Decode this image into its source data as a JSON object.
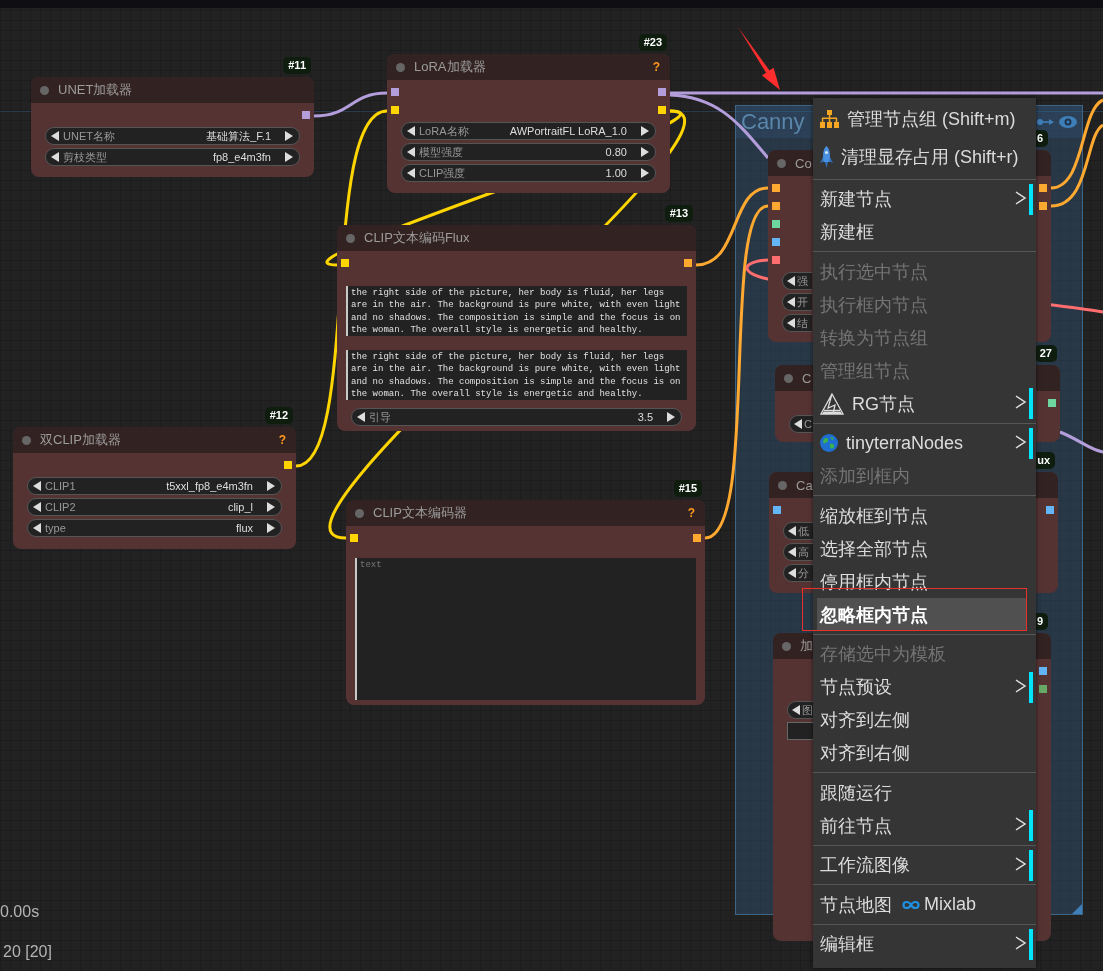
{
  "nodes": [
    {
      "badge": "#11",
      "title": "UNET加载器",
      "outputs": [
        {
          "color": "#b39ddb"
        }
      ],
      "widgets": [
        {
          "label": "UNET名称",
          "value": "基础算法_F.1"
        },
        {
          "label": "剪枝类型",
          "value": "fp8_e4m3fn"
        }
      ]
    },
    {
      "badge": "#23",
      "title": "LoRA加载器",
      "help_mark": "?",
      "inputs": [
        {
          "color": "#b39ddb"
        },
        {
          "color": "#ffd500"
        }
      ],
      "outputs": [
        {
          "color": "#b39ddb"
        },
        {
          "color": "#ffd500"
        }
      ],
      "widgets": [
        {
          "label": "LoRA名称",
          "value": "AWPortraitFL LoRA_1.0"
        },
        {
          "label": "模型强度",
          "value": "0.80"
        },
        {
          "label": "CLIP强度",
          "value": "1.00"
        }
      ]
    },
    {
      "badge": "#13",
      "title": "CLIP文本编码Flux",
      "inputs": [
        {
          "color": "#ffd500"
        }
      ],
      "outputs": [
        {
          "color": "#ffa931"
        }
      ],
      "text_areas": [
        {
          "value": "the right side of the picture, her body is fluid, her legs are in the air. The background is pure white, with even light and no shadows. The composition is simple and the focus is on the woman. The overall style is energetic and healthy."
        },
        {
          "value": "the right side of the picture, her body is fluid, her legs are in the air. The background is pure white, with even light and no shadows. The composition is simple and the focus is on the woman. The overall style is energetic and healthy."
        }
      ],
      "widgets": [
        {
          "label": "引导",
          "value": "3.5"
        }
      ]
    },
    {
      "badge": "#12",
      "title": "双CLIP加载器",
      "help_mark": "?",
      "outputs": [
        {
          "color": "#ffd500"
        }
      ],
      "widgets": [
        {
          "label": "CLIP1",
          "value": "t5xxl_fp8_e4m3fn"
        },
        {
          "label": "CLIP2",
          "value": "clip_l"
        },
        {
          "label": "type",
          "value": "flux"
        }
      ]
    },
    {
      "badge": "#15",
      "title": "CLIP文本编码器",
      "help_mark": "?",
      "inputs": [
        {
          "color": "#ffd500"
        }
      ],
      "outputs": [
        {
          "color": "#ffa931"
        }
      ],
      "text_areas": [
        {
          "placeholder": "text"
        }
      ]
    }
  ],
  "group": {
    "title": "Canny",
    "nodes": [
      {
        "badge": "6",
        "title": "Co",
        "inputs": [
          {
            "color": "#ffa931"
          },
          {
            "color": "#ffa931"
          },
          {
            "color": "#6fd6a0"
          },
          {
            "color": "#64b5f6"
          },
          {
            "color": "#ff6e6e"
          }
        ],
        "outputs": [
          {
            "color": "#ffa931"
          },
          {
            "color": "#ffa931"
          }
        ],
        "widgets": [
          {
            "label": "强"
          },
          {
            "label": "开"
          },
          {
            "label": "结"
          }
        ]
      },
      {
        "badge": "27",
        "title": "C",
        "outputs": [
          {
            "color": "#6fd6a0"
          }
        ],
        "widgets": [
          {
            "label": "C"
          }
        ]
      },
      {
        "badge": "ux",
        "title": "Ca",
        "inputs": [
          {
            "color": "#64b5f6"
          }
        ],
        "outputs": [
          {
            "color": "#64b5f6"
          }
        ],
        "widgets": [
          {
            "label": "低"
          },
          {
            "label": "高"
          },
          {
            "label": "分"
          }
        ]
      },
      {
        "badge": "9",
        "title": "加",
        "outputs": [
          {
            "color": "#64b5f6"
          },
          {
            "color": "#66aa66"
          }
        ],
        "widgets": [
          {
            "kind": "combo",
            "label": "图"
          },
          {
            "kind": "blank"
          }
        ]
      }
    ]
  },
  "context_menu": {
    "sections": [
      {
        "items": [
          {
            "label": "管理节点组 (Shift+m)",
            "disabled": false,
            "selected": false,
            "submenu": false
          },
          {
            "label": "清理显存占用 (Shift+r)",
            "disabled": false,
            "selected": false,
            "submenu": false
          }
        ]
      },
      {
        "items": [
          {
            "label": "新建节点",
            "disabled": false,
            "selected": false,
            "submenu": true
          },
          {
            "label": "新建框",
            "disabled": false,
            "selected": false,
            "submenu": false
          }
        ]
      },
      {
        "items": [
          {
            "label": "执行选中节点",
            "disabled": true,
            "selected": false,
            "submenu": false
          },
          {
            "label": "执行框内节点",
            "disabled": true,
            "selected": false,
            "submenu": false
          },
          {
            "label": "转换为节点组",
            "disabled": true,
            "selected": false,
            "submenu": false
          },
          {
            "label": "管理组节点",
            "disabled": true,
            "selected": false,
            "submenu": false
          },
          {
            "label": "RG节点",
            "disabled": false,
            "selected": false,
            "submenu": true
          }
        ]
      },
      {
        "items": [
          {
            "label": "tinyterraNodes",
            "disabled": false,
            "selected": false,
            "submenu": true
          },
          {
            "label": "添加到框内",
            "disabled": true,
            "selected": false,
            "submenu": false
          }
        ]
      },
      {
        "items": [
          {
            "label": "缩放框到节点",
            "disabled": false,
            "selected": false,
            "submenu": false
          },
          {
            "label": "选择全部节点",
            "disabled": false,
            "selected": false,
            "submenu": false
          },
          {
            "label": "停用框内节点",
            "disabled": false,
            "selected": false,
            "submenu": false
          },
          {
            "label": "忽略框内节点",
            "disabled": false,
            "selected": true,
            "submenu": false
          }
        ]
      },
      {
        "items": [
          {
            "label": "存储选中为模板",
            "disabled": true,
            "selected": false,
            "submenu": false
          },
          {
            "label": "节点预设",
            "disabled": false,
            "selected": false,
            "submenu": true
          },
          {
            "label": "对齐到左侧",
            "disabled": false,
            "selected": false,
            "submenu": false
          },
          {
            "label": "对齐到右侧",
            "disabled": false,
            "selected": false,
            "submenu": false
          }
        ]
      },
      {
        "items": [
          {
            "label": "跟随运行",
            "disabled": false,
            "selected": false,
            "submenu": false
          },
          {
            "label": "前往节点",
            "disabled": false,
            "selected": false,
            "submenu": true
          }
        ]
      },
      {
        "items": [
          {
            "label": "工作流图像",
            "disabled": false,
            "selected": false,
            "submenu": true
          }
        ]
      },
      {
        "items": [
          {
            "label": "节点地图",
            "suffix": "Mixlab",
            "disabled": false,
            "selected": false,
            "submenu": false
          }
        ]
      },
      {
        "items": [
          {
            "label": "编辑框",
            "disabled": false,
            "selected": false,
            "submenu": true
          }
        ]
      }
    ]
  },
  "stats": [
    "0.00s",
    "20 [20]"
  ]
}
